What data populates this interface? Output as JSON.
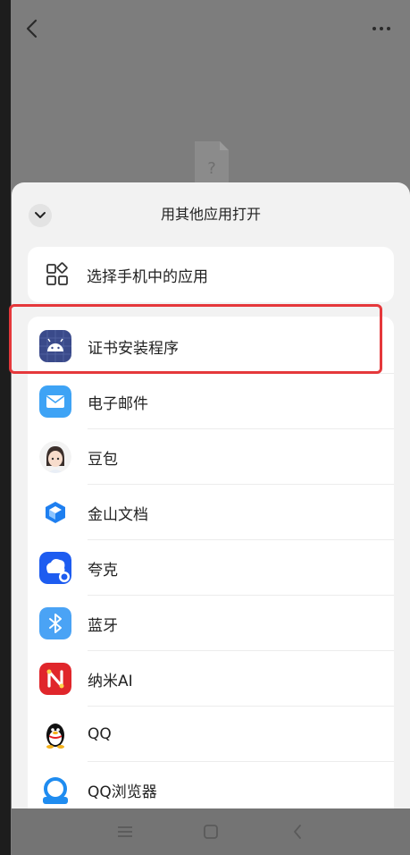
{
  "sheet": {
    "title": "用其他应用打开",
    "choose_app_label": "选择手机中的应用"
  },
  "apps": [
    {
      "label": "证书安装程序",
      "icon": "android-icon"
    },
    {
      "label": "电子邮件",
      "icon": "email-icon"
    },
    {
      "label": "豆包",
      "icon": "doubao-icon"
    },
    {
      "label": "金山文档",
      "icon": "kingsoft-docs-icon"
    },
    {
      "label": "夸克",
      "icon": "quark-icon"
    },
    {
      "label": "蓝牙",
      "icon": "bluetooth-icon"
    },
    {
      "label": "纳米AI",
      "icon": "nami-ai-icon"
    },
    {
      "label": "QQ",
      "icon": "qq-icon"
    },
    {
      "label": "QQ浏览器",
      "icon": "qq-browser-icon"
    }
  ],
  "colors": {
    "highlight": "#e5383b",
    "email_blue": "#3ea3f5",
    "bluetooth_blue": "#4aa3f5",
    "quark_blue": "#1d5cf0"
  }
}
